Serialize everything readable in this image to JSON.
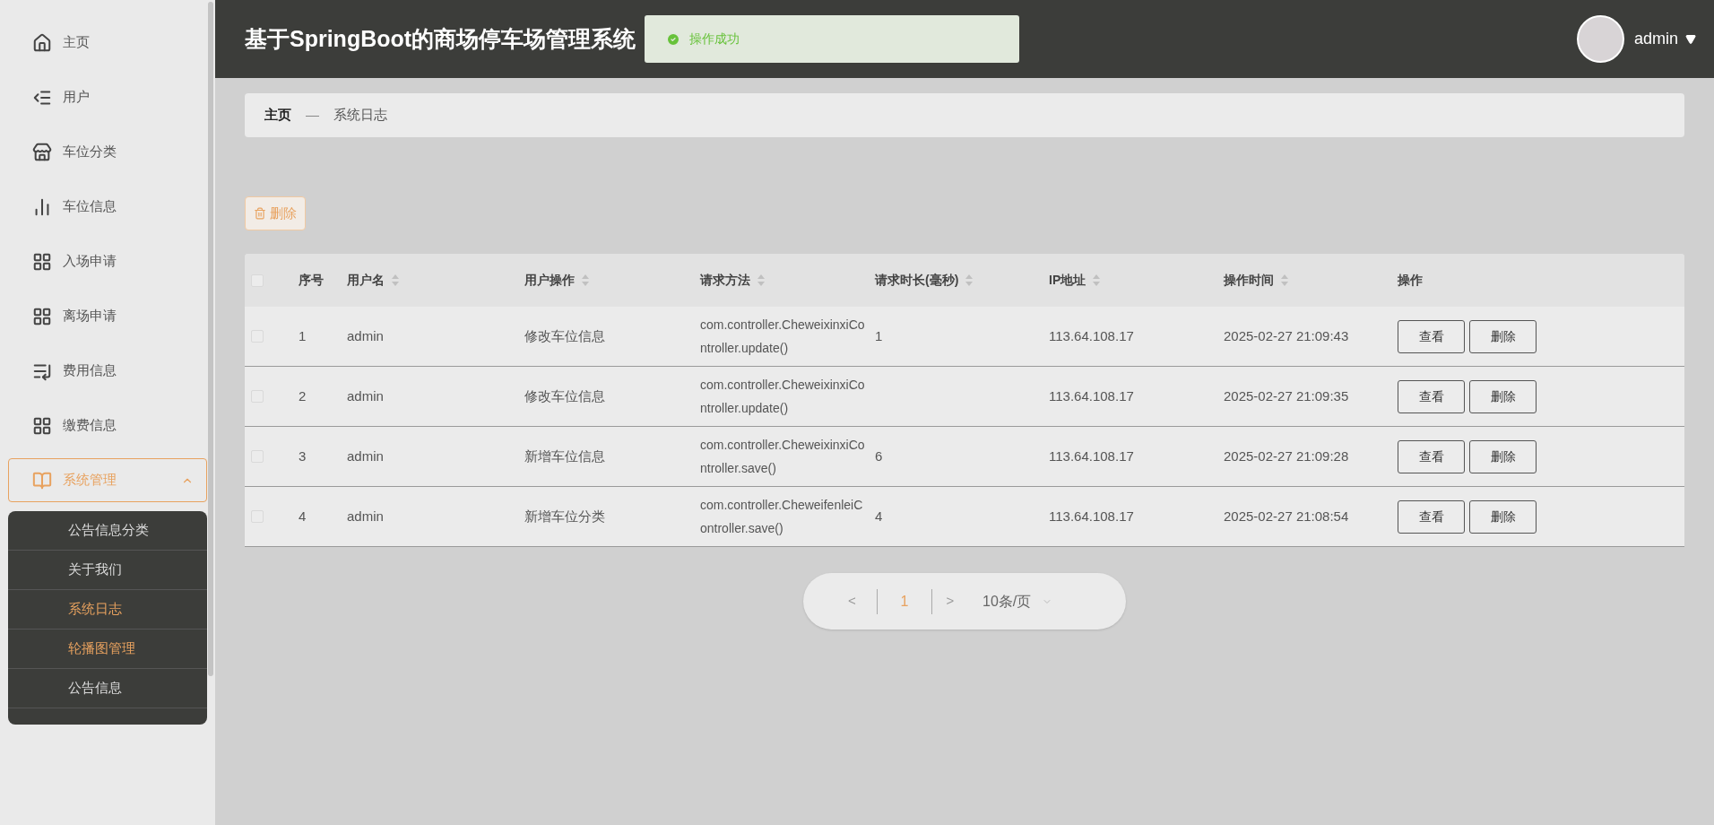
{
  "sidebar": {
    "items": [
      {
        "label": "主页",
        "selected": false
      },
      {
        "label": "用户",
        "selected": false
      },
      {
        "label": "车位分类",
        "selected": false
      },
      {
        "label": "车位信息",
        "selected": false
      },
      {
        "label": "入场申请",
        "selected": false
      },
      {
        "label": "离场申请",
        "selected": false
      },
      {
        "label": "费用信息",
        "selected": false
      },
      {
        "label": "缴费信息",
        "selected": false
      },
      {
        "label": "系统管理",
        "expanded": true,
        "selected": true,
        "children": [
          {
            "label": "公告信息分类",
            "highlighted": false
          },
          {
            "label": "关于我们",
            "highlighted": false
          },
          {
            "label": "系统日志",
            "highlighted": true
          },
          {
            "label": "轮播图管理",
            "highlighted": true
          },
          {
            "label": "公告信息",
            "highlighted": false
          }
        ]
      }
    ]
  },
  "header": {
    "title": "基于SpringBoot的商场停车场管理系统",
    "toast": "操作成功",
    "user": "admin"
  },
  "breadcrumb": {
    "items": [
      "主页",
      "系统日志"
    ],
    "separator": "—"
  },
  "toolbar": {
    "delete_button": "删除"
  },
  "table": {
    "select_all_checked": false,
    "columns": [
      {
        "label": "序号",
        "sortable": false
      },
      {
        "label": "用户名",
        "sortable": true
      },
      {
        "label": "用户操作",
        "sortable": true
      },
      {
        "label": "请求方法",
        "sortable": true
      },
      {
        "label": "请求时长(毫秒)",
        "sortable": true
      },
      {
        "label": "IP地址",
        "sortable": true
      },
      {
        "label": "操作时间",
        "sortable": true
      },
      {
        "label": "操作",
        "sortable": false
      }
    ],
    "rows": [
      {
        "checked": false,
        "index": "1",
        "username": "admin",
        "operation": "修改车位信息",
        "method": "com.controller.CheweixinxiController.update()",
        "duration": "1",
        "ip": "113.64.108.17",
        "time": "2025-02-27 21:09:43",
        "actions": [
          "查看",
          "删除"
        ]
      },
      {
        "checked": false,
        "index": "2",
        "username": "admin",
        "operation": "修改车位信息",
        "method": "com.controller.CheweixinxiController.update()",
        "ip": "113.64.108.17",
        "time": "2025-02-27 21:09:35",
        "actions": [
          "查看",
          "删除"
        ]
      },
      {
        "checked": false,
        "index": "3",
        "username": "admin",
        "operation": "新增车位信息",
        "method": "com.controller.CheweixinxiController.save()",
        "duration": "6",
        "ip": "113.64.108.17",
        "time": "2025-02-27 21:09:28",
        "actions": [
          "查看",
          "删除"
        ]
      },
      {
        "checked": false,
        "index": "4",
        "username": "admin",
        "operation": "新增车位分类",
        "method": "com.controller.CheweifenleiController.save()",
        "duration": "4",
        "ip": "113.64.108.17",
        "time": "2025-02-27 21:08:54",
        "actions": [
          "查看",
          "删除"
        ]
      }
    ]
  },
  "pagination": {
    "prev": "<",
    "pages": [
      {
        "label": "1",
        "selected": true
      }
    ],
    "next": ">",
    "page_size": "10条/页"
  }
}
